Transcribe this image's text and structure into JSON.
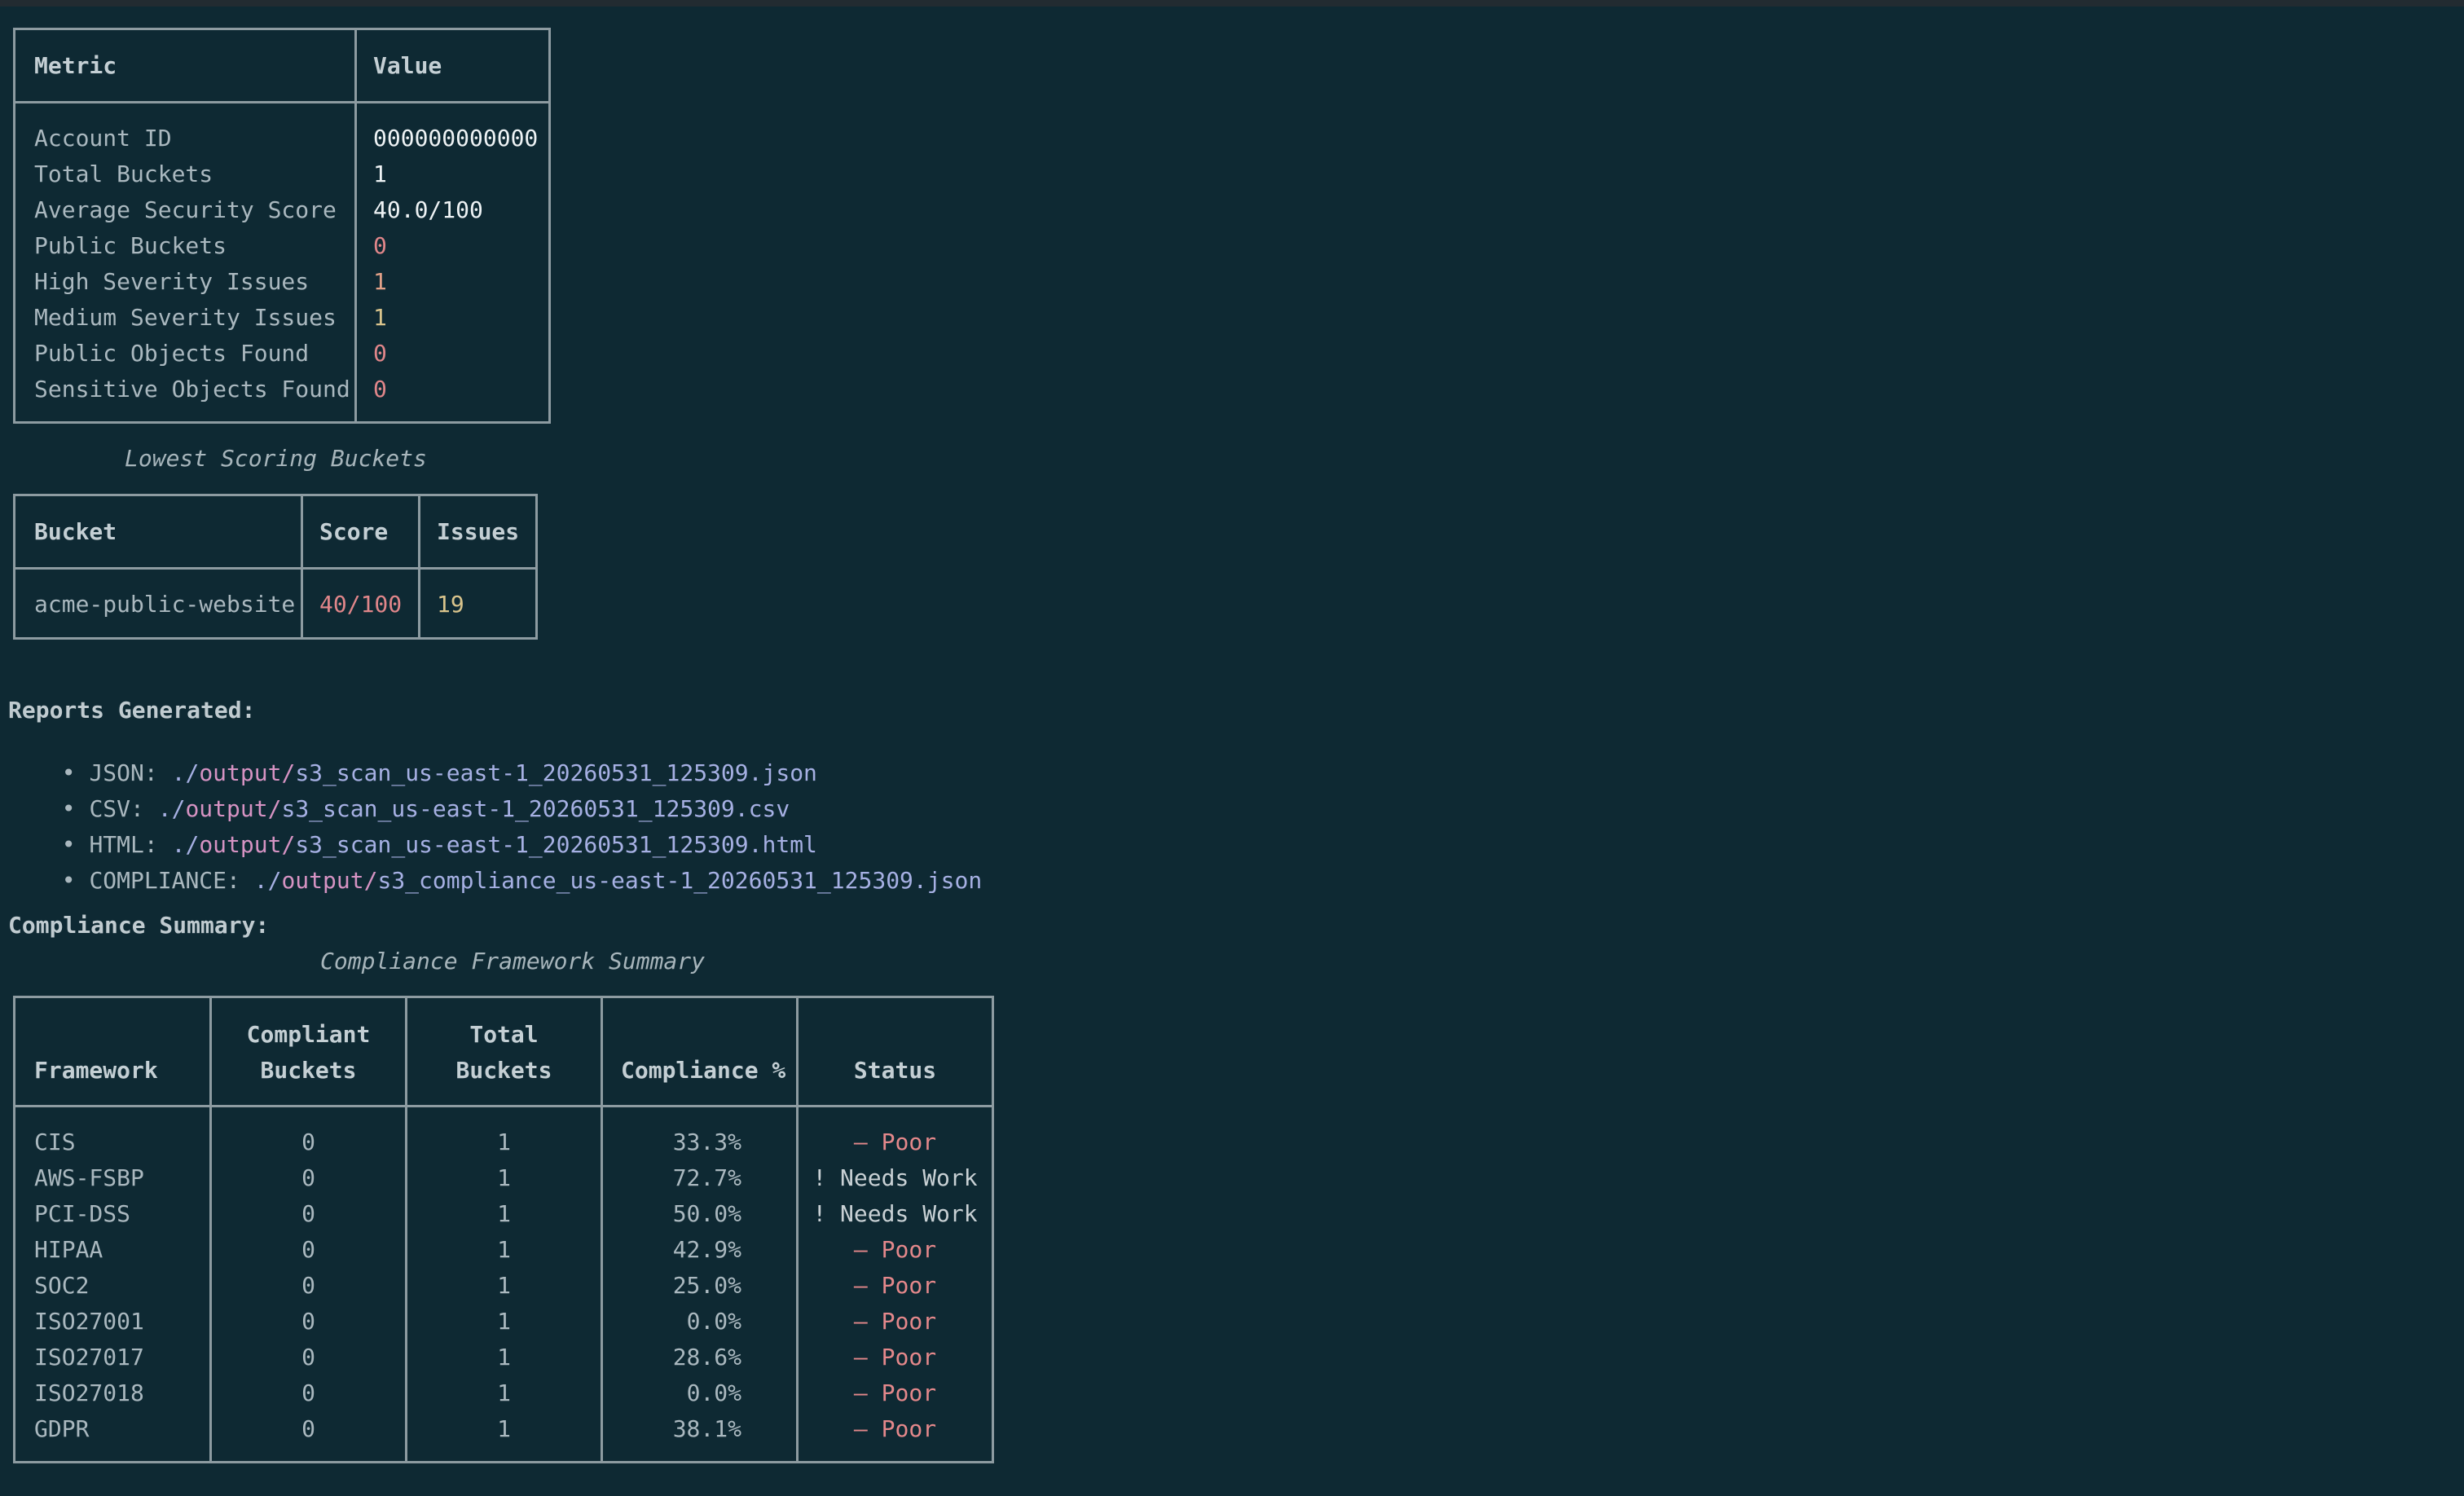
{
  "summary": {
    "headers": {
      "metric": "Metric",
      "value": "Value"
    },
    "rows": [
      {
        "label": "Account ID",
        "value": "000000000000",
        "tone": "white"
      },
      {
        "label": "Total Buckets",
        "value": "1",
        "tone": "white"
      },
      {
        "label": "Average Security Score",
        "value": "40.0/100",
        "tone": "white"
      },
      {
        "label": "Public Buckets",
        "value": "0",
        "tone": "red"
      },
      {
        "label": "High Severity Issues",
        "value": "1",
        "tone": "orange"
      },
      {
        "label": "Medium Severity Issues",
        "value": "1",
        "tone": "yellow"
      },
      {
        "label": "Public Objects Found",
        "value": "0",
        "tone": "red"
      },
      {
        "label": "Sensitive Objects Found",
        "value": "0",
        "tone": "red"
      }
    ]
  },
  "lowest": {
    "caption": "Lowest Scoring Buckets",
    "headers": {
      "bucket": "Bucket",
      "score": "Score",
      "issues": "Issues"
    },
    "rows": [
      {
        "bucket": "acme-public-website",
        "score": "40/100",
        "issues": "19"
      }
    ]
  },
  "reports": {
    "title": "Reports Generated:",
    "bullet": "•",
    "items": [
      {
        "label": "JSON:",
        "dir": "./",
        "path": "output/",
        "file": "s3_scan_us-east-1_20260531_125309.json"
      },
      {
        "label": "CSV:",
        "dir": "./",
        "path": "output/",
        "file": "s3_scan_us-east-1_20260531_125309.csv"
      },
      {
        "label": "HTML:",
        "dir": "./",
        "path": "output/",
        "file": "s3_scan_us-east-1_20260531_125309.html"
      },
      {
        "label": "COMPLIANCE:",
        "dir": "./",
        "path": "output/",
        "file": "s3_compliance_us-east-1_20260531_125309.json"
      }
    ]
  },
  "compliance": {
    "title": "Compliance Summary:",
    "caption": "Compliance Framework Summary",
    "headers": {
      "framework": "Framework",
      "compliant_1": "Compliant",
      "compliant_2": "Buckets",
      "total_1": "Total",
      "total_2": "Buckets",
      "pct": "Compliance %",
      "status": "Status"
    },
    "rows": [
      {
        "framework": "CIS",
        "compliant": "0",
        "total": "1",
        "pct": "33.3%",
        "status": "– Poor",
        "tone": "poor"
      },
      {
        "framework": "AWS-FSBP",
        "compliant": "0",
        "total": "1",
        "pct": "72.7%",
        "status": "! Needs Work",
        "tone": "warn"
      },
      {
        "framework": "PCI-DSS",
        "compliant": "0",
        "total": "1",
        "pct": "50.0%",
        "status": "! Needs Work",
        "tone": "warn"
      },
      {
        "framework": "HIPAA",
        "compliant": "0",
        "total": "1",
        "pct": "42.9%",
        "status": "– Poor",
        "tone": "poor"
      },
      {
        "framework": "SOC2",
        "compliant": "0",
        "total": "1",
        "pct": "25.0%",
        "status": "– Poor",
        "tone": "poor"
      },
      {
        "framework": "ISO27001",
        "compliant": "0",
        "total": "1",
        "pct": "0.0%",
        "status": "– Poor",
        "tone": "poor"
      },
      {
        "framework": "ISO27017",
        "compliant": "0",
        "total": "1",
        "pct": "28.6%",
        "status": "– Poor",
        "tone": "poor"
      },
      {
        "framework": "ISO27018",
        "compliant": "0",
        "total": "1",
        "pct": "0.0%",
        "status": "– Poor",
        "tone": "poor"
      },
      {
        "framework": "GDPR",
        "compliant": "0",
        "total": "1",
        "pct": "38.1%",
        "status": "– Poor",
        "tone": "poor"
      }
    ]
  },
  "colors": {
    "background": "#0e2933",
    "border": "#8d9ba1",
    "bad": "#e0868a",
    "high": "#e2a188",
    "medium": "#d9c48c",
    "path_dir": "#d693c3",
    "path_file": "#a6b0e3"
  }
}
